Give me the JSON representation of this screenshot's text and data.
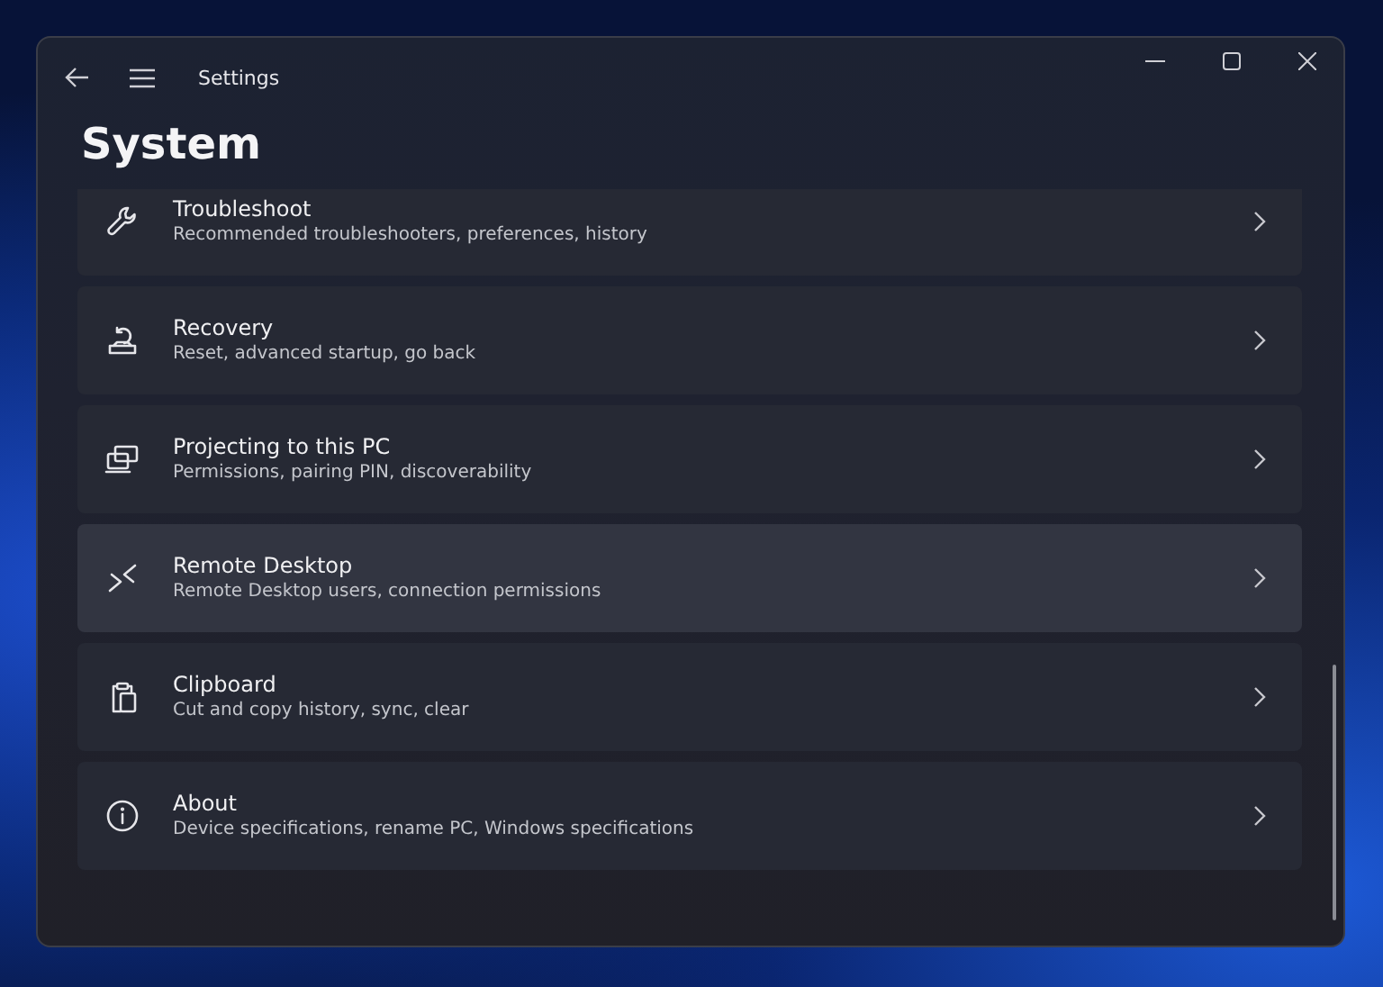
{
  "window": {
    "title": "Settings"
  },
  "page": {
    "heading": "System"
  },
  "items": [
    {
      "title": "Troubleshoot",
      "subtitle": "Recommended troubleshooters, preferences, history",
      "hovered": false
    },
    {
      "title": "Recovery",
      "subtitle": "Reset, advanced startup, go back",
      "hovered": false
    },
    {
      "title": "Projecting to this PC",
      "subtitle": "Permissions, pairing PIN, discoverability",
      "hovered": false
    },
    {
      "title": "Remote Desktop",
      "subtitle": "Remote Desktop users, connection permissions",
      "hovered": true
    },
    {
      "title": "Clipboard",
      "subtitle": "Cut and copy history, sync, clear",
      "hovered": false
    },
    {
      "title": "About",
      "subtitle": "Device specifications, rename PC, Windows specifications",
      "hovered": false
    }
  ]
}
